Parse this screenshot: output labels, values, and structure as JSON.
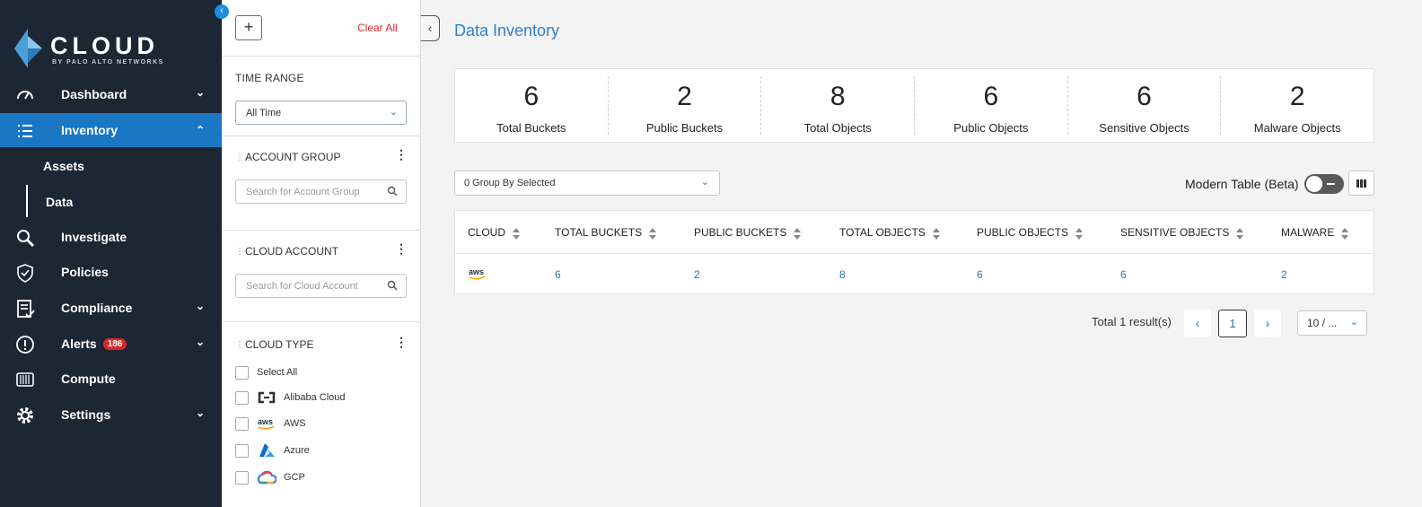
{
  "sidebar": {
    "logo_word": "CLOUD",
    "logo_sub": "BY PALO ALTO NETWORKS",
    "nav": [
      {
        "label": "Dashboard",
        "icon": "dashboard-icon"
      },
      {
        "label": "Inventory",
        "icon": "inventory-icon"
      },
      {
        "label": "Investigate",
        "icon": "investigate-icon"
      },
      {
        "label": "Policies",
        "icon": "policies-icon"
      },
      {
        "label": "Compliance",
        "icon": "compliance-icon"
      },
      {
        "label": "Alerts",
        "icon": "alerts-icon",
        "badge": "186"
      },
      {
        "label": "Compute",
        "icon": "compute-icon"
      },
      {
        "label": "Settings",
        "icon": "settings-icon"
      }
    ],
    "inventory_sub": [
      "Assets",
      "Data"
    ]
  },
  "filters": {
    "clear_all": "Clear All",
    "time_range_title": "TIME RANGE",
    "time_range_value": "All Time",
    "account_group_title": "ACCOUNT GROUP",
    "account_group_placeholder": "Search for Account Group",
    "cloud_account_title": "CLOUD ACCOUNT",
    "cloud_account_placeholder": "Search for Cloud Account",
    "cloud_type_title": "CLOUD TYPE",
    "cloud_types": [
      "Select All",
      "Alibaba Cloud",
      "AWS",
      "Azure",
      "GCP"
    ]
  },
  "main": {
    "title": "Data Inventory",
    "stats": [
      {
        "value": "6",
        "label": "Total Buckets"
      },
      {
        "value": "2",
        "label": "Public Buckets"
      },
      {
        "value": "8",
        "label": "Total Objects"
      },
      {
        "value": "6",
        "label": "Public Objects"
      },
      {
        "value": "6",
        "label": "Sensitive Objects"
      },
      {
        "value": "2",
        "label": "Malware Objects"
      }
    ],
    "group_by": "0 Group By Selected",
    "modern_table_label": "Modern Table (Beta)",
    "table": {
      "columns": [
        "CLOUD",
        "TOTAL BUCKETS",
        "PUBLIC BUCKETS",
        "TOTAL OBJECTS",
        "PUBLIC OBJECTS",
        "SENSITIVE OBJECTS",
        "MALWARE"
      ],
      "row": {
        "cloud_icon": "aws-icon",
        "values": [
          "6",
          "2",
          "8",
          "6",
          "6",
          "2"
        ]
      }
    },
    "pagination": {
      "total": "Total 1 result(s)",
      "page": "1",
      "page_size": "10 / ..."
    }
  },
  "colors": {
    "sidebar_bg": "#1d2734",
    "active_nav": "#1a77c4",
    "link_blue": "#1a77c4",
    "title_blue": "#2f7fcf",
    "clear_red": "#d92a2a"
  }
}
